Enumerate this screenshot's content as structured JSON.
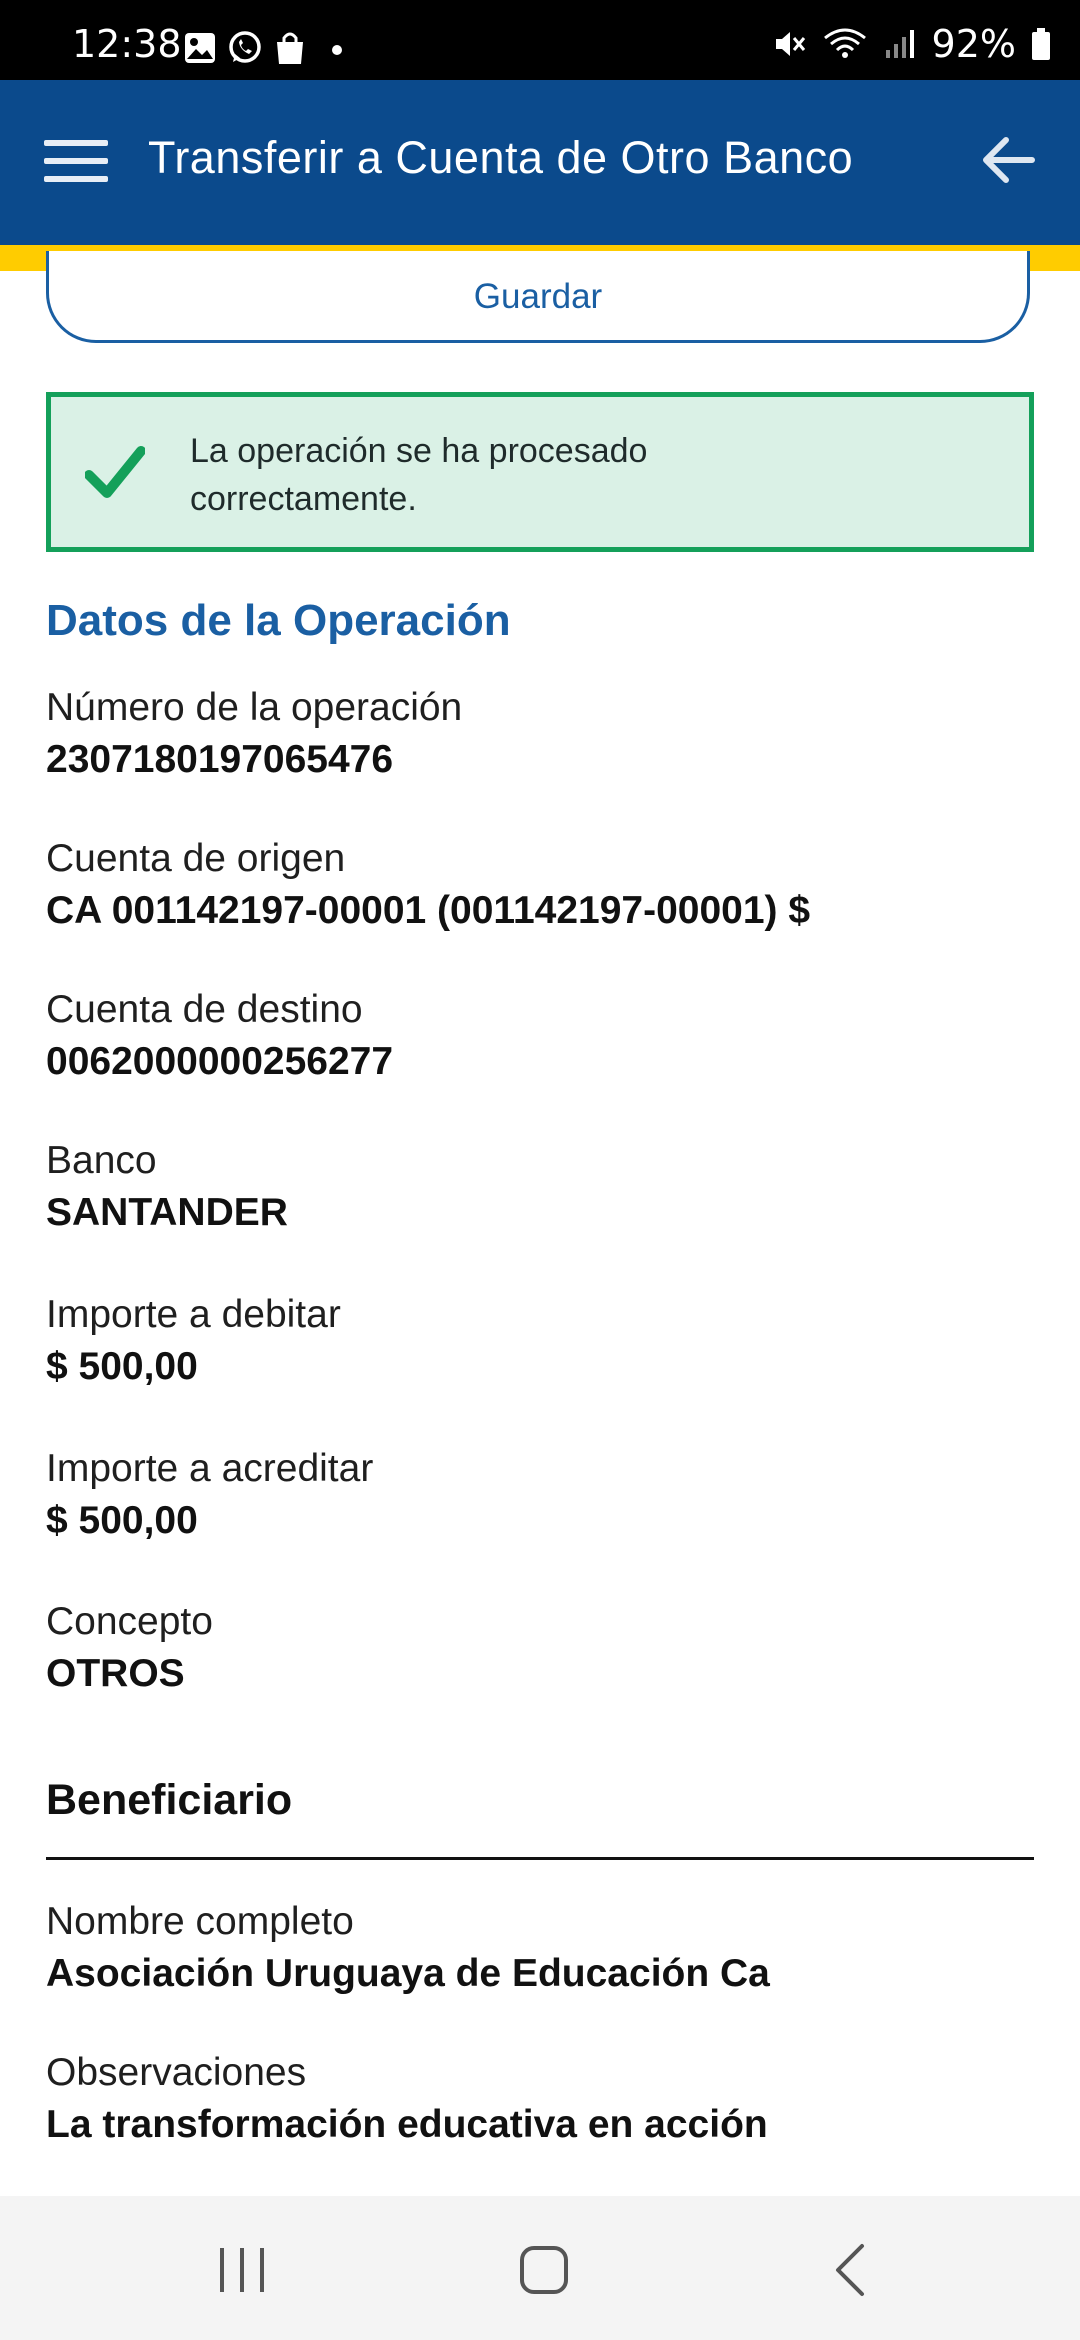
{
  "status_bar": {
    "time": "12:38",
    "battery": "92%",
    "left_icons": [
      "image-icon",
      "whatsapp-icon",
      "shopping-bag-icon",
      "dot-icon"
    ],
    "right_icons": [
      "mute-icon",
      "wifi-icon",
      "signal-icon",
      "battery-icon"
    ]
  },
  "app_bar": {
    "title": "Transferir a Cuenta de Otro Banco",
    "background": "#0b4a8c",
    "stripe_color": "#ffcc00"
  },
  "save_button": {
    "label": "Guardar"
  },
  "success_message": {
    "line1": "La operación se ha procesado",
    "line2": "correctamente.",
    "color": "#14a05a"
  },
  "operation": {
    "title": "Datos de la Operación",
    "fields": [
      {
        "label": "Número de la operación",
        "value": "2307180197065476"
      },
      {
        "label": "Cuenta de origen",
        "value": "CA 001142197-00001 (001142197-00001) $"
      },
      {
        "label": "Cuenta de destino",
        "value": "0062000000256277"
      },
      {
        "label": "Banco",
        "value": "SANTANDER"
      },
      {
        "label": "Importe a debitar",
        "value": "$ 500,00"
      },
      {
        "label": "Importe a acreditar",
        "value": "$ 500,00"
      },
      {
        "label": "Concepto",
        "value": "OTROS"
      }
    ]
  },
  "beneficiary": {
    "title": "Beneficiario",
    "fields": [
      {
        "label": "Nombre completo",
        "value": "Asociación Uruguaya de Educación Ca"
      },
      {
        "label": "Observaciones",
        "value": "La transformación educativa en acción"
      }
    ]
  },
  "nav_bar": {
    "buttons": [
      "recents-icon",
      "home-icon",
      "back-nav-icon"
    ]
  }
}
